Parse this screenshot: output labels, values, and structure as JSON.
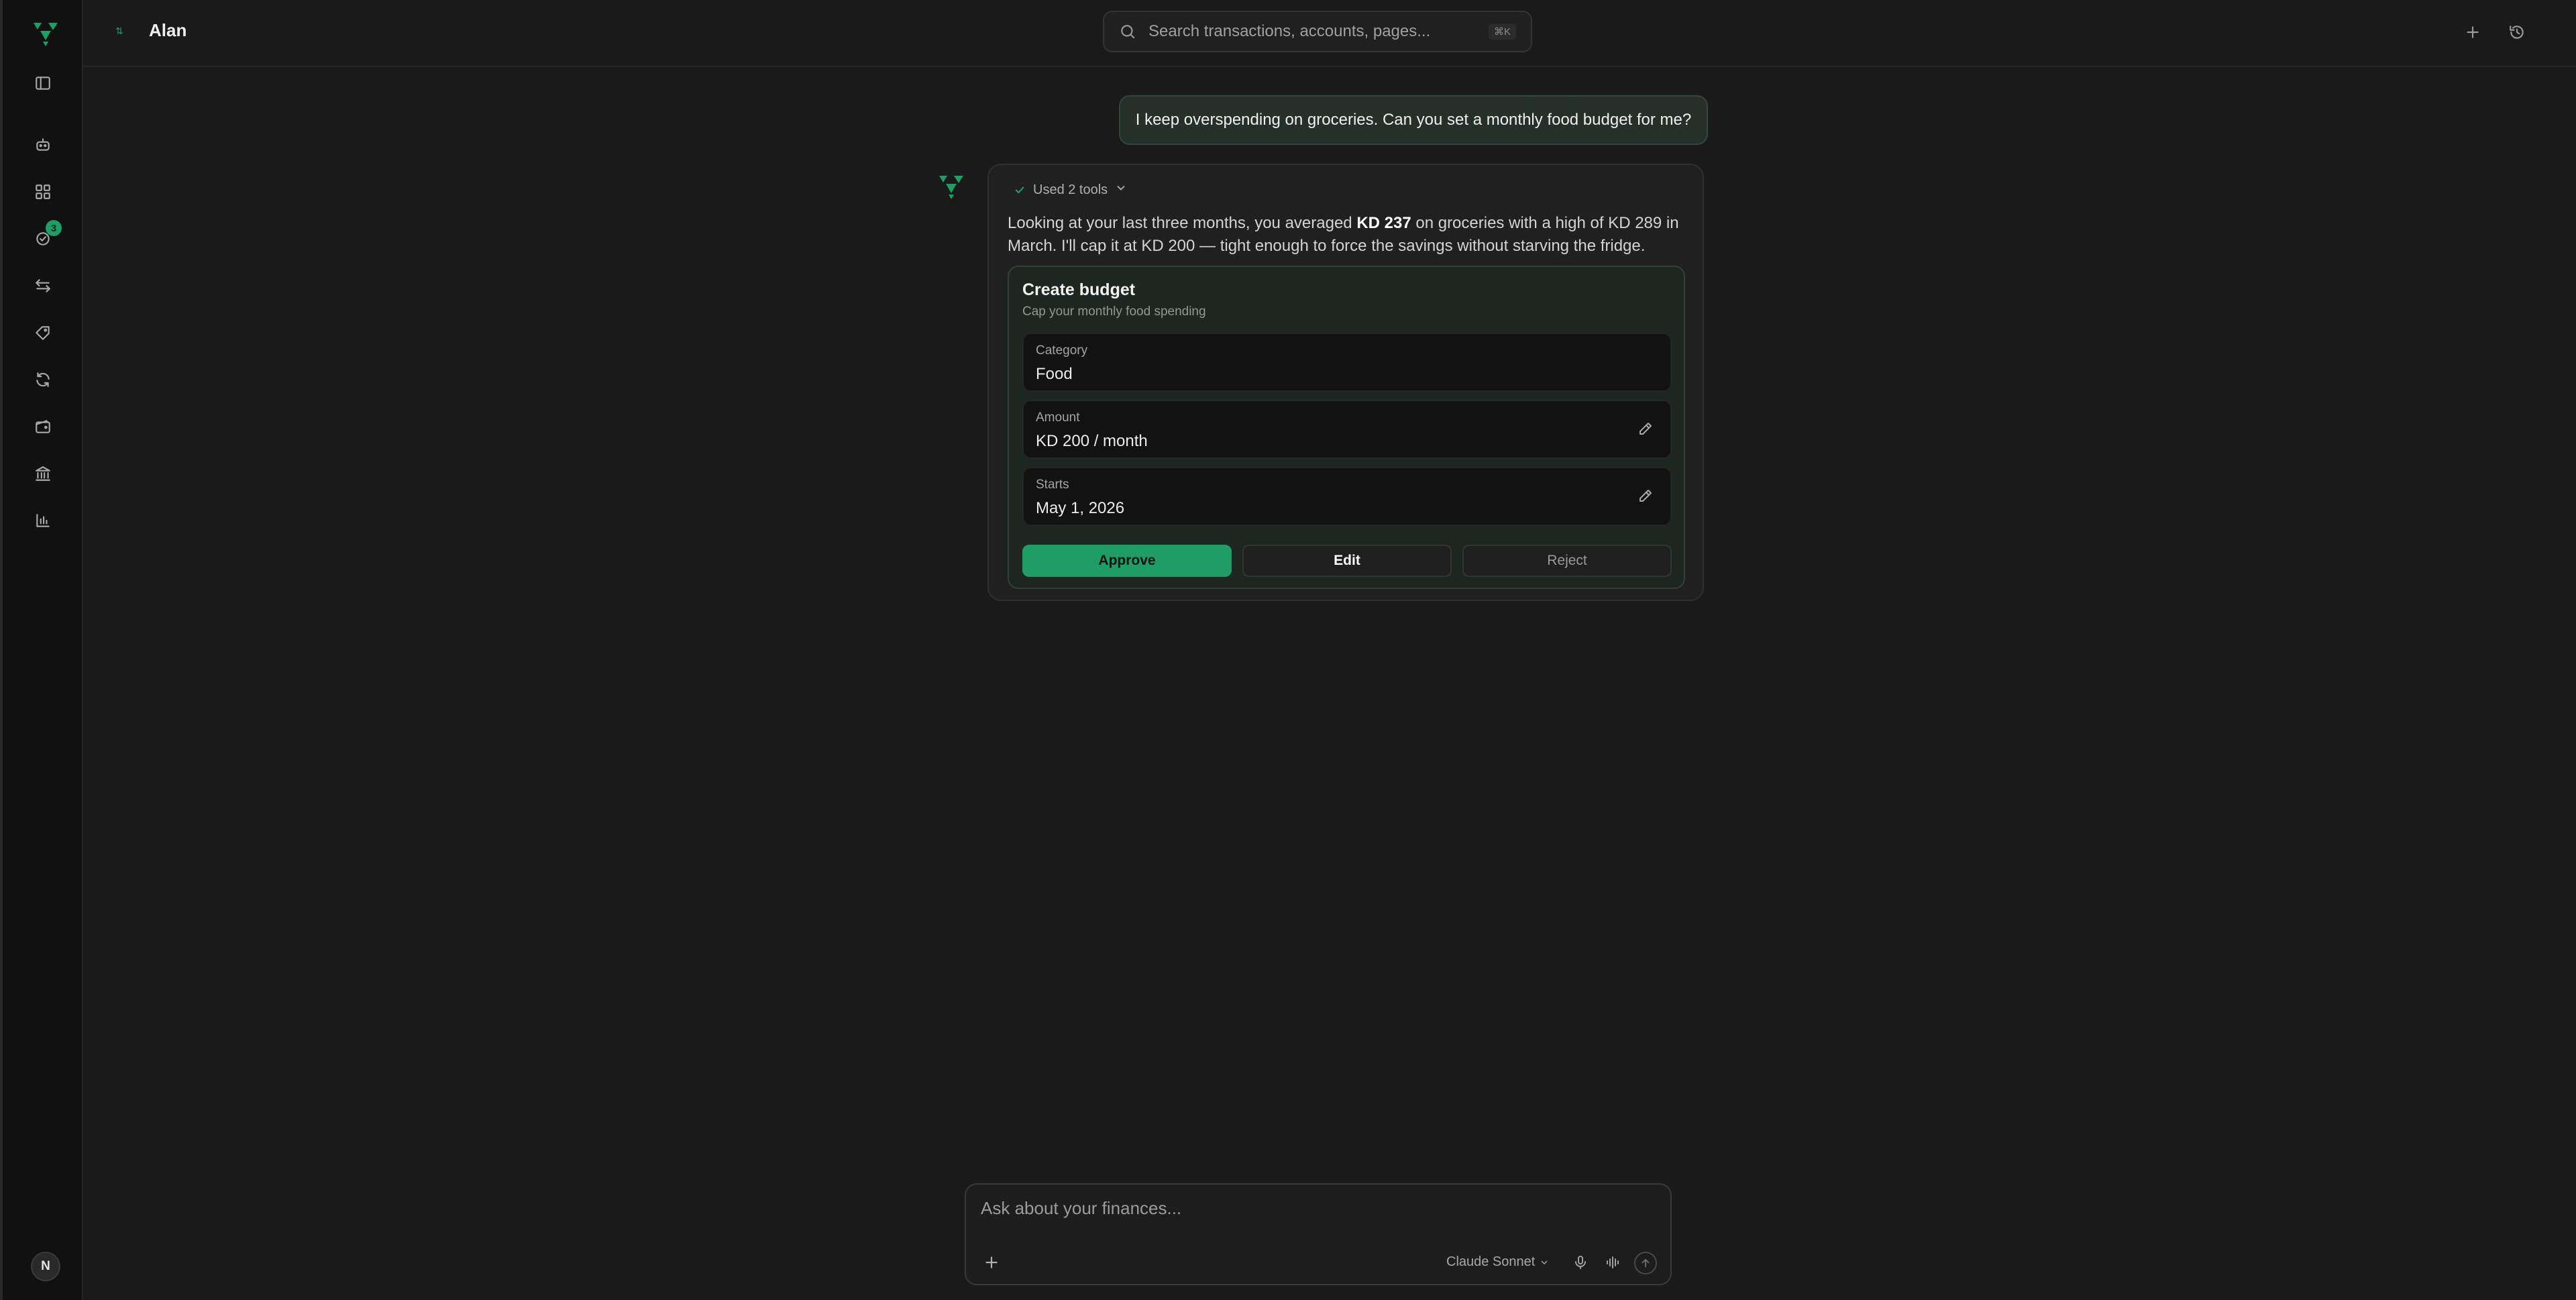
{
  "header": {
    "user_name": "Alan",
    "search_placeholder": "Search transactions, accounts, pages...",
    "search_shortcut": "⌘K"
  },
  "sidebar": {
    "items": [
      {
        "name": "toggle-sidebar",
        "icon": "panel-left-icon"
      },
      {
        "name": "assistant",
        "icon": "bot-icon"
      },
      {
        "name": "overview",
        "icon": "grid-icon"
      },
      {
        "name": "tasks",
        "icon": "check-circle-icon",
        "badge": "3"
      },
      {
        "name": "transactions",
        "icon": "arrows-icon"
      },
      {
        "name": "tags",
        "icon": "tag-icon"
      },
      {
        "name": "recurring",
        "icon": "refresh-icon"
      },
      {
        "name": "wallet",
        "icon": "wallet-icon"
      },
      {
        "name": "accounts",
        "icon": "bank-icon"
      },
      {
        "name": "reports",
        "icon": "chart-icon"
      }
    ],
    "avatar_initial": "N"
  },
  "conversation": {
    "user_message": "I keep overspending on groceries. Can you set a monthly food budget for me?",
    "tools_used": "Used 2 tools",
    "reply_part1": "Looking at your last three months, you averaged ",
    "reply_bold": "KD 237",
    "reply_part2": " on groceries with a high of KD 289 in March. I'll cap it at KD 200 — tight enough to force the savings without starving the fridge."
  },
  "budget_card": {
    "title": "Create budget",
    "subtitle": "Cap your monthly food spending",
    "fields": [
      {
        "label": "Category",
        "value": "Food"
      },
      {
        "label": "Amount",
        "value": "KD 200 / month"
      },
      {
        "label": "Starts",
        "value": "May 1, 2026"
      }
    ],
    "approve_label": "Approve",
    "edit_label": "Edit",
    "reject_label": "Reject"
  },
  "composer": {
    "placeholder": "Ask about your finances...",
    "model": "Claude Sonnet"
  },
  "colors": {
    "accent": "#1f9d66",
    "background": "#1a1a1a",
    "sidebar": "#111111"
  }
}
